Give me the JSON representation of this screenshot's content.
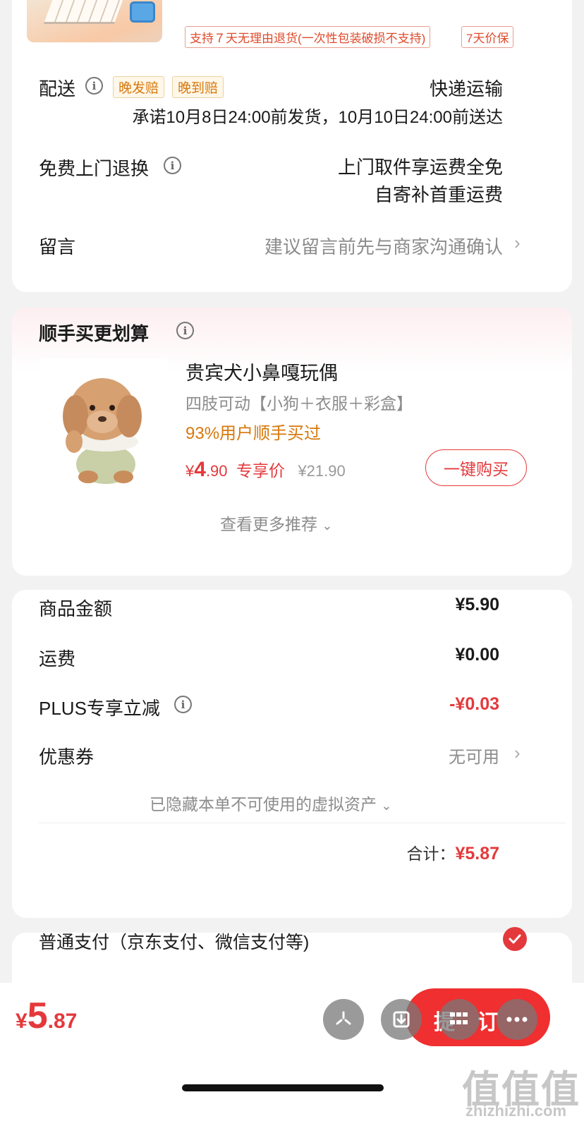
{
  "top_product": {
    "return_tag": "支持７天无理由退货(一次性包装破损不支持)",
    "price_protect_tag": "7天价保"
  },
  "delivery": {
    "label": "配送",
    "tags": [
      "晚发赔",
      "晚到赔"
    ],
    "method": "快递运输",
    "promise": "承诺10月8日24:00前发货，10月10日24:00前送达"
  },
  "free_return": {
    "label": "免费上门退换",
    "line1": "上门取件享运费全免",
    "line2": "自寄补首重运费"
  },
  "message": {
    "label": "留言",
    "placeholder": "建议留言前先与商家沟通确认"
  },
  "addon": {
    "title": "顺手买更划算",
    "product_name": "贵宾犬小鼻嘎玩偶",
    "spec": "四肢可动【小狗＋衣服＋彩盒】",
    "social_proof": "93%用户顺手买过",
    "price_symbol": "¥",
    "price_int": "4",
    "price_dec": ".90",
    "price_label": "专享价",
    "orig_price": "¥21.90",
    "buy_button": "一键购买",
    "more": "查看更多推荐"
  },
  "summary": {
    "goods_label": "商品金额",
    "goods_value": "¥5.90",
    "shipping_label": "运费",
    "shipping_value": "¥0.00",
    "plus_label": "PLUS专享立减",
    "plus_value": "-¥0.03",
    "coupon_label": "优惠券",
    "coupon_value": "无可用",
    "hidden_assets": "已隐藏本单不可使用的虚拟资产",
    "total_label": "合计：",
    "total_value": "¥5.87"
  },
  "payment": {
    "method": "普通支付（京东支付、微信支付等)"
  },
  "bottom": {
    "price_symbol": "¥",
    "price_int": "5",
    "price_dec": ".87",
    "submit_visible": "提",
    "submit_visible2": "订"
  },
  "watermark": {
    "logo": "值值值",
    "domain": "zhizhizhi.com"
  },
  "colors": {
    "accent_red": "#e4393c",
    "orange": "#d7780c",
    "bg": "#f2f2f2"
  }
}
